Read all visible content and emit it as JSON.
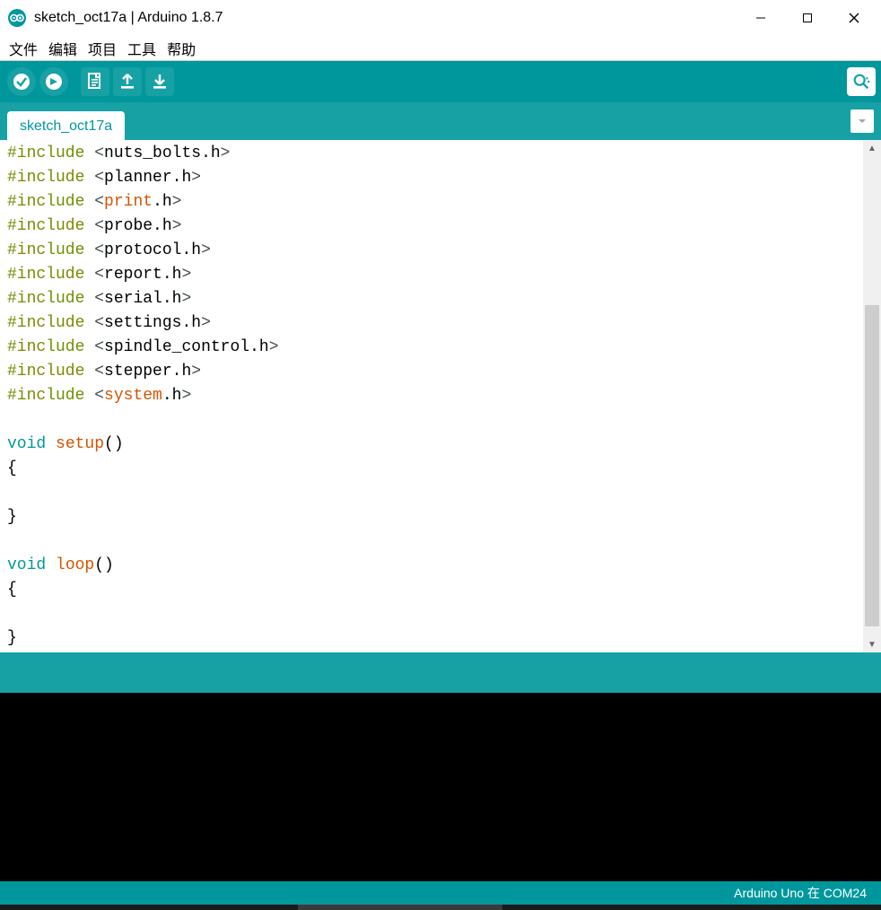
{
  "title": "sketch_oct17a | Arduino 1.8.7",
  "menu": {
    "file": "文件",
    "edit": "编辑",
    "sketch": "项目",
    "tools": "工具",
    "help": "帮助"
  },
  "tab": {
    "name": "sketch_oct17a"
  },
  "code": {
    "lines": [
      {
        "t": "include",
        "header": "nuts_bolts.h"
      },
      {
        "t": "include",
        "header": "planner.h"
      },
      {
        "t": "include",
        "header": "print.h",
        "hl": "print"
      },
      {
        "t": "include",
        "header": "probe.h"
      },
      {
        "t": "include",
        "header": "protocol.h"
      },
      {
        "t": "include",
        "header": "report.h"
      },
      {
        "t": "include",
        "header": "serial.h"
      },
      {
        "t": "include",
        "header": "settings.h"
      },
      {
        "t": "include",
        "header": "spindle_control.h"
      },
      {
        "t": "include",
        "header": "stepper.h"
      },
      {
        "t": "include",
        "header": "system.h",
        "hl": "system"
      },
      {
        "t": "blank"
      },
      {
        "t": "func",
        "ret": "void",
        "name": "setup",
        "args": "()"
      },
      {
        "t": "raw",
        "text": "{"
      },
      {
        "t": "blank"
      },
      {
        "t": "raw",
        "text": "}"
      },
      {
        "t": "blank"
      },
      {
        "t": "func",
        "ret": "void",
        "name": "loop",
        "args": "()"
      },
      {
        "t": "raw",
        "text": "{"
      },
      {
        "t": "blank"
      },
      {
        "t": "raw",
        "text": "}"
      }
    ]
  },
  "footer": {
    "board": "Arduino Uno 在 COM24"
  }
}
